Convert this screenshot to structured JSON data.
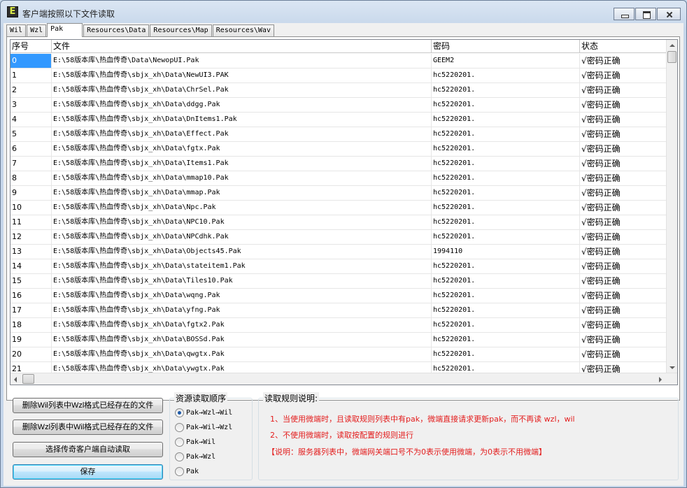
{
  "window": {
    "title": "客户端按照以下文件读取",
    "icon_letter": "E"
  },
  "tabs": [
    {
      "label": "Wil",
      "active": false
    },
    {
      "label": "Wzl",
      "active": false
    },
    {
      "label": "Pak",
      "active": true
    },
    {
      "label": "Resources\\Data",
      "active": false
    },
    {
      "label": "Resources\\Map",
      "active": false
    },
    {
      "label": "Resources\\Wav",
      "active": false
    }
  ],
  "grid": {
    "headers": [
      "序号",
      "文件",
      "密码",
      "状态"
    ],
    "rows": [
      [
        "0",
        "E:\\58版本库\\热血传奇\\Data\\NewopUI.Pak",
        "GEEM2",
        "√密码正确"
      ],
      [
        "1",
        "E:\\58版本库\\热血传奇\\sbjx_xh\\Data\\NewUI3.PAK",
        "hc5220201.",
        "√密码正确"
      ],
      [
        "2",
        "E:\\58版本库\\热血传奇\\sbjx_xh\\Data\\ChrSel.Pak",
        "hc5220201.",
        "√密码正确"
      ],
      [
        "3",
        "E:\\58版本库\\热血传奇\\sbjx_xh\\Data\\ddgg.Pak",
        "hc5220201.",
        "√密码正确"
      ],
      [
        "4",
        "E:\\58版本库\\热血传奇\\sbjx_xh\\Data\\DnItems1.Pak",
        "hc5220201.",
        "√密码正确"
      ],
      [
        "5",
        "E:\\58版本库\\热血传奇\\sbjx_xh\\Data\\Effect.Pak",
        "hc5220201.",
        "√密码正确"
      ],
      [
        "6",
        "E:\\58版本库\\热血传奇\\sbjx_xh\\Data\\fgtx.Pak",
        "hc5220201.",
        "√密码正确"
      ],
      [
        "7",
        "E:\\58版本库\\热血传奇\\sbjx_xh\\Data\\Items1.Pak",
        "hc5220201.",
        "√密码正确"
      ],
      [
        "8",
        "E:\\58版本库\\热血传奇\\sbjx_xh\\Data\\mmap10.Pak",
        "hc5220201.",
        "√密码正确"
      ],
      [
        "9",
        "E:\\58版本库\\热血传奇\\sbjx_xh\\Data\\mmap.Pak",
        "hc5220201.",
        "√密码正确"
      ],
      [
        "10",
        "E:\\58版本库\\热血传奇\\sbjx_xh\\Data\\Npc.Pak",
        "hc5220201.",
        "√密码正确"
      ],
      [
        "11",
        "E:\\58版本库\\热血传奇\\sbjx_xh\\Data\\NPC10.Pak",
        "hc5220201.",
        "√密码正确"
      ],
      [
        "12",
        "E:\\58版本库\\热血传奇\\sbjx_xh\\Data\\NPCdhk.Pak",
        "hc5220201.",
        "√密码正确"
      ],
      [
        "13",
        "E:\\58版本库\\热血传奇\\sbjx_xh\\Data\\Objects45.Pak",
        "1994110",
        "√密码正确"
      ],
      [
        "14",
        "E:\\58版本库\\热血传奇\\sbjx_xh\\Data\\stateitem1.Pak",
        "hc5220201.",
        "√密码正确"
      ],
      [
        "15",
        "E:\\58版本库\\热血传奇\\sbjx_xh\\Data\\Tiles10.Pak",
        "hc5220201.",
        "√密码正确"
      ],
      [
        "16",
        "E:\\58版本库\\热血传奇\\sbjx_xh\\Data\\wqng.Pak",
        "hc5220201.",
        "√密码正确"
      ],
      [
        "17",
        "E:\\58版本库\\热血传奇\\sbjx_xh\\Data\\yfng.Pak",
        "hc5220201.",
        "√密码正确"
      ],
      [
        "18",
        "E:\\58版本库\\热血传奇\\sbjx_xh\\Data\\fgtx2.Pak",
        "hc5220201.",
        "√密码正确"
      ],
      [
        "19",
        "E:\\58版本库\\热血传奇\\sbjx_xh\\Data\\BOSSd.Pak",
        "hc5220201.",
        "√密码正确"
      ],
      [
        "20",
        "E:\\58版本库\\热血传奇\\sbjx_xh\\Data\\qwgtx.Pak",
        "hc5220201.",
        "√密码正确"
      ],
      [
        "21",
        "E:\\58版本库\\热血传奇\\sbjx_xh\\Data\\ywgtx.Pak",
        "hc5220201.",
        "√密码正确"
      ]
    ],
    "selected_row": 0
  },
  "buttons": {
    "delete_wil": "删除Wil列表中Wzl格式已经存在的文件",
    "delete_wzl": "删除Wzl列表中Wil格式已经存在的文件",
    "select_client": "选择传奇客户端自动读取",
    "save": "保存"
  },
  "read_order": {
    "title": "资源读取顺序",
    "options": [
      {
        "label": "Pak→Wzl→Wil",
        "checked": true
      },
      {
        "label": "Pak→Wil→Wzl",
        "checked": false
      },
      {
        "label": "Pak→Wil",
        "checked": false
      },
      {
        "label": "Pak→Wzl",
        "checked": false
      },
      {
        "label": "Pak",
        "checked": false
      }
    ]
  },
  "rules": {
    "title": "读取规则说明:",
    "line1": "1、当使用微端时，且读取规则列表中有pak，微端直接请求更新pak，而不再读 wzl，wil",
    "line2": "2、不使用微端时，读取按配置的规则进行",
    "line3": "【说明：服务器列表中，微端网关端口号不为0表示使用微端，为0表示不用微端】",
    "color": "#e31d1d"
  }
}
